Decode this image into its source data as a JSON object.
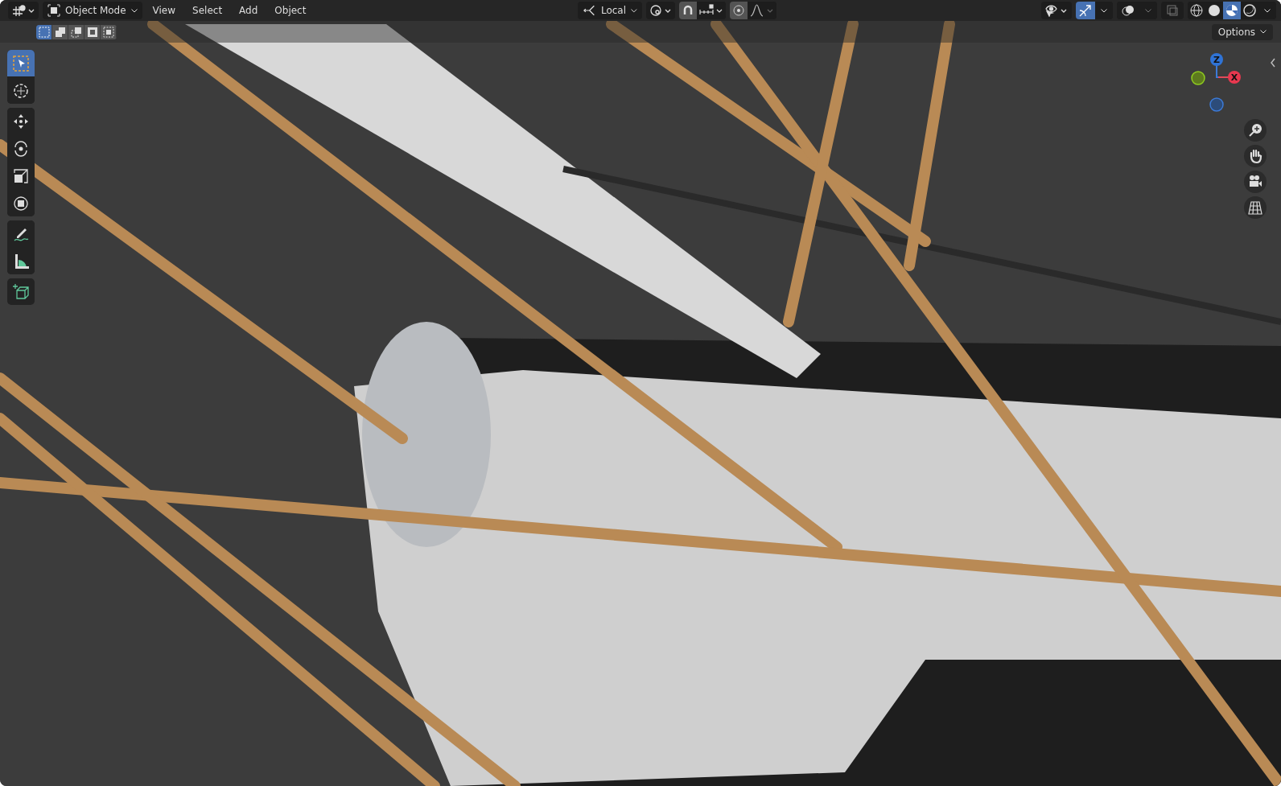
{
  "header": {
    "mode": "Object Mode",
    "menus": [
      "View",
      "Select",
      "Add",
      "Object"
    ],
    "orientation": "Local",
    "snapping": {
      "on": false
    },
    "proportional_editing": {
      "on": false
    },
    "gizmos": {
      "on": true
    },
    "shading_modes": [
      {
        "kind": "wireframe",
        "selected": false
      },
      {
        "kind": "solid",
        "selected": false
      },
      {
        "kind": "material",
        "selected": true
      },
      {
        "kind": "rendered",
        "selected": false
      }
    ]
  },
  "tool_settings": {
    "select_modes": [
      {
        "kind": "new",
        "selected": true
      },
      {
        "kind": "extend",
        "selected": false
      },
      {
        "kind": "subtract",
        "selected": false
      },
      {
        "kind": "difference",
        "selected": false
      },
      {
        "kind": "intersect",
        "selected": false
      }
    ],
    "options": "Options"
  },
  "toolbar": [
    {
      "kind": "select",
      "selected": true
    },
    {
      "kind": "cursor",
      "selected": false
    },
    {
      "kind": "move",
      "selected": false
    },
    {
      "kind": "rotate",
      "selected": false
    },
    {
      "kind": "scale",
      "selected": false
    },
    {
      "kind": "transform",
      "selected": false
    },
    {
      "kind": "annotate",
      "selected": false
    },
    {
      "kind": "measure",
      "selected": false
    },
    {
      "kind": "add-cube",
      "selected": false
    }
  ],
  "axis_gizmo": {
    "z": "Z",
    "x": "X"
  }
}
